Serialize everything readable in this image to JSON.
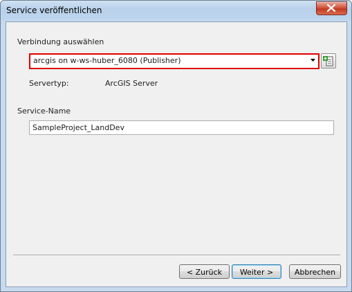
{
  "window": {
    "title": "Service veröffentlichen"
  },
  "connection": {
    "label": "Verbindung auswählen",
    "selected": "arcgis on w-ws-huber_6080 (Publisher)"
  },
  "server_type": {
    "label": "Servertyp:",
    "value": "ArcGIS Server"
  },
  "service_name": {
    "label": "Service-Name",
    "value": "SampleProject_LandDev"
  },
  "buttons": {
    "back": "< Zurück",
    "next": "Weiter >",
    "cancel": "Abbrechen"
  },
  "colors": {
    "highlight_border": "#e00000",
    "close_button": "#c23b22"
  },
  "icons": {
    "close": "close-icon",
    "dropdown": "chevron-down-icon",
    "add_connection": "add-server-connection-icon"
  }
}
